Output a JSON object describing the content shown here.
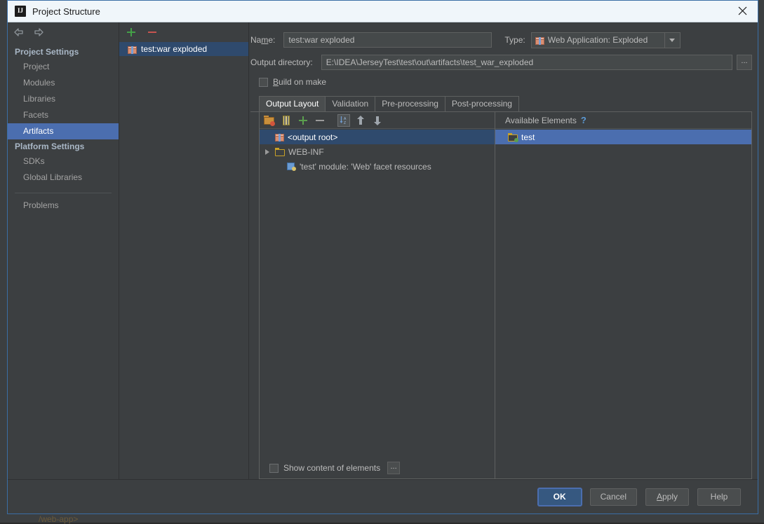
{
  "window": {
    "title": "Project Structure",
    "app_icon": "intellij-idea-icon",
    "close_icon": "close-icon"
  },
  "nav": {
    "back_icon": "arrow-left-icon",
    "forward_icon": "arrow-right-icon"
  },
  "sidebar": {
    "groups": [
      {
        "label": "Project Settings",
        "items": [
          {
            "label": "Project",
            "selected": false
          },
          {
            "label": "Modules",
            "selected": false
          },
          {
            "label": "Libraries",
            "selected": false
          },
          {
            "label": "Facets",
            "selected": false
          },
          {
            "label": "Artifacts",
            "selected": true
          }
        ]
      },
      {
        "label": "Platform Settings",
        "items": [
          {
            "label": "SDKs",
            "selected": false
          },
          {
            "label": "Global Libraries",
            "selected": false
          }
        ]
      }
    ],
    "problems_label": "Problems"
  },
  "artifacts_panel": {
    "add_icon": "plus-icon",
    "remove_icon": "minus-icon",
    "items": [
      {
        "label": "test:war exploded",
        "icon": "artifact-gift-icon",
        "selected": true
      }
    ]
  },
  "editor": {
    "name_label": "Name:",
    "name_label_mnemonic": "m",
    "name_value": "test:war exploded",
    "type_label": "Type:",
    "type_value": "Web Application: Exploded",
    "type_icon": "artifact-gift-icon",
    "type_dropdown_icon": "chevron-down-icon",
    "output_dir_label": "Output directory:",
    "output_dir_value": "E:\\IDEA\\JerseyTest\\test\\out\\artifacts\\test_war_exploded",
    "browse_label": "...",
    "build_on_make_label": "Build on make",
    "build_on_make_checked": false,
    "tabs": [
      {
        "label": "Output Layout",
        "active": true
      },
      {
        "label": "Validation",
        "active": false
      },
      {
        "label": "Pre-processing",
        "active": false
      },
      {
        "label": "Post-processing",
        "active": false
      }
    ],
    "layout_toolbar": [
      {
        "name": "add-directory-icon"
      },
      {
        "name": "add-archive-icon"
      },
      {
        "name": "add-copy-of-icon"
      },
      {
        "name": "remove-icon"
      },
      {
        "name": "sort-by-type-icon",
        "pressed": true
      },
      {
        "name": "move-up-icon"
      },
      {
        "name": "move-down-icon"
      }
    ],
    "tree": [
      {
        "label": "<output root>",
        "icon": "artifact-gift-icon",
        "depth": 0,
        "twisty": false,
        "selected": true
      },
      {
        "label": "WEB-INF",
        "icon": "folder-icon",
        "depth": 0,
        "twisty": true,
        "selected": false
      },
      {
        "label": "'test' module: 'Web' facet resources",
        "icon": "module-icon",
        "depth": 1,
        "twisty": false,
        "selected": false
      }
    ],
    "available_elements_label": "Available Elements",
    "available_help_icon": "help-question-icon",
    "available_items": [
      {
        "label": "test",
        "icon": "folder-green-icon",
        "selected": true
      }
    ],
    "show_content_label": "Show content of elements",
    "show_content_checked": false,
    "show_content_more_label": "..."
  },
  "footer": {
    "buttons": [
      {
        "label": "OK",
        "default": true,
        "mnemonic": ""
      },
      {
        "label": "Cancel",
        "default": false,
        "mnemonic": ""
      },
      {
        "label": "Apply",
        "default": false,
        "mnemonic": "A"
      },
      {
        "label": "Help",
        "default": false,
        "mnemonic": ""
      }
    ]
  },
  "background": {
    "partial_text": "/web-app>"
  },
  "colors": {
    "dialog_bg": "#3c3f41",
    "selection_blue": "#4b6eaf",
    "selection_dark_blue": "#2f4a6d",
    "titlebar_bg": "#f0f6fa",
    "default_button": "#365880",
    "accent_green": "#43a047",
    "accent_red": "#c75450"
  }
}
